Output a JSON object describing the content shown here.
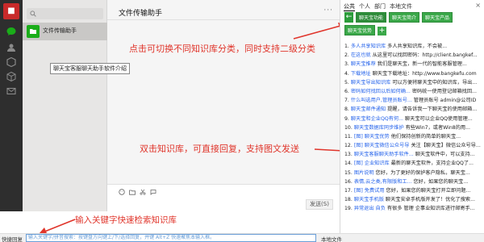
{
  "contact": {
    "name": "文件传输助手"
  },
  "search": {
    "placeholder": ""
  },
  "chat": {
    "title": "文件传输助手",
    "more": "···",
    "tooltip": "聊天宝客服聊天助手软件介绍",
    "send_label": "发送(S)"
  },
  "annotations": {
    "top": "点击可切换不同知识库分类，同时支持二级分类",
    "middle": "双击知识库，可直接回复，支持图文发送",
    "bottom": "输入关键字快速检索知识库"
  },
  "quick_reply": {
    "label": "快捷回复",
    "placeholder": "输入关键字/拼音搜索：按键盘方向键上/下/选择回复，并键 Alt+Z 快速聚焦本输入框。",
    "right_label": "本地文件"
  },
  "panel": {
    "tabs": [
      "公共",
      "个人",
      "部门",
      "本地文件"
    ],
    "close": "×",
    "buttons": [
      "聊天宝功能",
      "聊天宝简介",
      "聊天宝产品",
      "聊天宝优势"
    ],
    "back_glyph": "←",
    "plus_glyph": "+",
    "items": [
      {
        "num": "1.",
        "title": "多人共享知识库",
        "desc": "多人共享知识库，不会被..."
      },
      {
        "num": "2.",
        "title": "在这也就",
        "desc": "从这里可以找回密码：http://client.bangkef..."
      },
      {
        "num": "3.",
        "title": "聊天宝推荐",
        "desc": "我们是聊天宝，新一代的智能客服管理..."
      },
      {
        "num": "4.",
        "title": "下载地址",
        "desc": "聊天宝下载地址：http://www.bangkefu.com"
      },
      {
        "num": "5.",
        "title": "聊天宝导出知识库",
        "desc": "可以方便将聊天宝中的知识库，导出..."
      },
      {
        "num": "6.",
        "title": "密码如何找回以后如何确...",
        "desc": "密码统一使用登记邮箱找回..."
      },
      {
        "num": "7.",
        "title": "什么叫选用户,管理员账号...",
        "desc": "管理员账号 admin@公司ID"
      },
      {
        "num": "8.",
        "title": "聊天宝邮件通知",
        "desc": "提醒，请告诉我一下聊天宝的使用邮箱..."
      },
      {
        "num": "9.",
        "title": "聊天宝和企业QQ有何...",
        "desc": "聊天宝可以企业QQ使用管理..."
      },
      {
        "num": "10.",
        "title": "聊天宝数据库同步维护",
        "desc": "有些Win7，或者Win8的用..."
      },
      {
        "num": "11.",
        "title": "[图] 聊天宝优势",
        "desc": "他们保持创新的简单的聊天宝..."
      },
      {
        "num": "12.",
        "title": "[图] 聊天宝微信公众号导",
        "desc": "关注【聊天宝】微信公众号导..."
      },
      {
        "num": "13.",
        "title": "聊天宝客服聊天助手软件...",
        "desc": "聊天宝软件中，可以支持..."
      },
      {
        "num": "14.",
        "title": "[图] 企业知识库",
        "desc": "最新的聊天宝软件，支持企业QQ了..."
      },
      {
        "num": "15.",
        "title": "图片说明",
        "desc": "您好，为了更好的保护客户隐私，聊天宝..."
      },
      {
        "num": "16.",
        "title": "表情,云之类,有限版和工...",
        "desc": "您好，如果您的聊天宝..."
      },
      {
        "num": "17.",
        "title": "[图] 免费试用",
        "desc": "您好，如果您的聊天宝打开立即问题..."
      },
      {
        "num": "18.",
        "title": "聊天宝手机版",
        "desc": "聊天宝安卓手机版开发了！优化了搜索..."
      },
      {
        "num": "19.",
        "title": "异常退出 自负",
        "desc": "有很多 管理 企事业知识库进行邮寄手..."
      }
    ]
  }
}
